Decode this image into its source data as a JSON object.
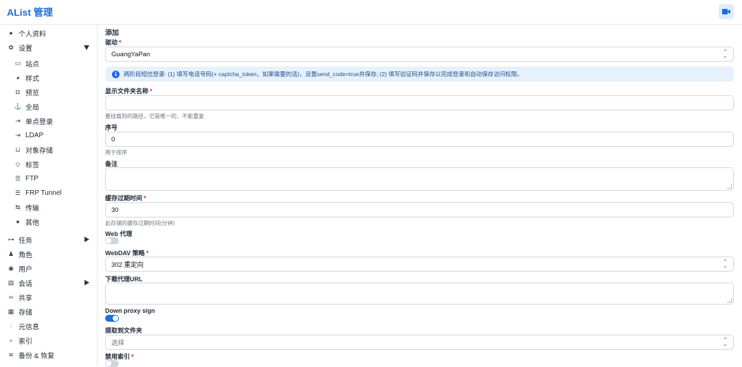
{
  "app": {
    "title": "AList 管理"
  },
  "sidebar": {
    "items": [
      {
        "label": "个人资料",
        "icon": "user-icon"
      },
      {
        "label": "设置",
        "icon": "gear-icon",
        "expanded": true
      },
      {
        "label": "站点",
        "icon": "window-icon"
      },
      {
        "label": "样式",
        "icon": "palette-icon"
      },
      {
        "label": "预览",
        "icon": "camera-icon"
      },
      {
        "label": "全局",
        "icon": "anchor-icon"
      },
      {
        "label": "单点登录",
        "icon": "login-icon"
      },
      {
        "label": "LDAP",
        "icon": "login-icon"
      },
      {
        "label": "对象存储",
        "icon": "bucket-icon"
      },
      {
        "label": "标签",
        "icon": "tag-icon"
      },
      {
        "label": "FTP",
        "icon": "server-icon"
      },
      {
        "label": "FRP Tunnel",
        "icon": "server-icon"
      },
      {
        "label": "传输",
        "icon": "transfer-icon"
      },
      {
        "label": "其他",
        "icon": "dots-icon"
      },
      {
        "label": "任务",
        "icon": "tasks-icon"
      },
      {
        "label": "角色",
        "icon": "role-icon"
      },
      {
        "label": "用户",
        "icon": "user-circle-icon"
      },
      {
        "label": "会话",
        "icon": "chat-icon"
      },
      {
        "label": "共享",
        "icon": "link-icon"
      },
      {
        "label": "存储",
        "icon": "storage-icon"
      },
      {
        "label": "元信息",
        "icon": "meta-icon"
      },
      {
        "label": "索引",
        "icon": "search-icon"
      },
      {
        "label": "备份 & 恢复",
        "icon": "database-icon"
      }
    ]
  },
  "form": {
    "heading": "添加",
    "driver": {
      "label": "驱动",
      "value": "GuangYaPan"
    },
    "info": "两阶段短信登录: (1) 填写电话号码(+ captcha_token，如果需要的话)，设置send_code=true并保存; (2) 填写验证码并保存以完成登录和自动保存访问权限。",
    "mount_path": {
      "label": "显示文件夹名称",
      "value": "",
      "hint": "要挂载到的路径，它是唯一的，不能重复"
    },
    "order": {
      "label": "序号",
      "value": "0",
      "hint": "用于排序"
    },
    "remark": {
      "label": "备注",
      "value": ""
    },
    "cache": {
      "label": "缓存过期时间",
      "value": "30",
      "hint": "此存储的缓存过期时间(分钟)"
    },
    "web_proxy": {
      "label": "Web 代理",
      "on": false
    },
    "webdav": {
      "label": "WebDAV 策略",
      "value": "302 重定向"
    },
    "download_url": {
      "label": "下载代理URL",
      "value": ""
    },
    "down_proxy_sign": {
      "label": "Down proxy sign",
      "on": true
    },
    "extract_folder": {
      "label": "提取到文件夹",
      "value": "选择"
    },
    "disable_index": {
      "label": "禁用索引"
    }
  },
  "colors": {
    "accent": "#1f6fd6",
    "required": "#dc2626",
    "info_bg": "#e7f1fc"
  }
}
